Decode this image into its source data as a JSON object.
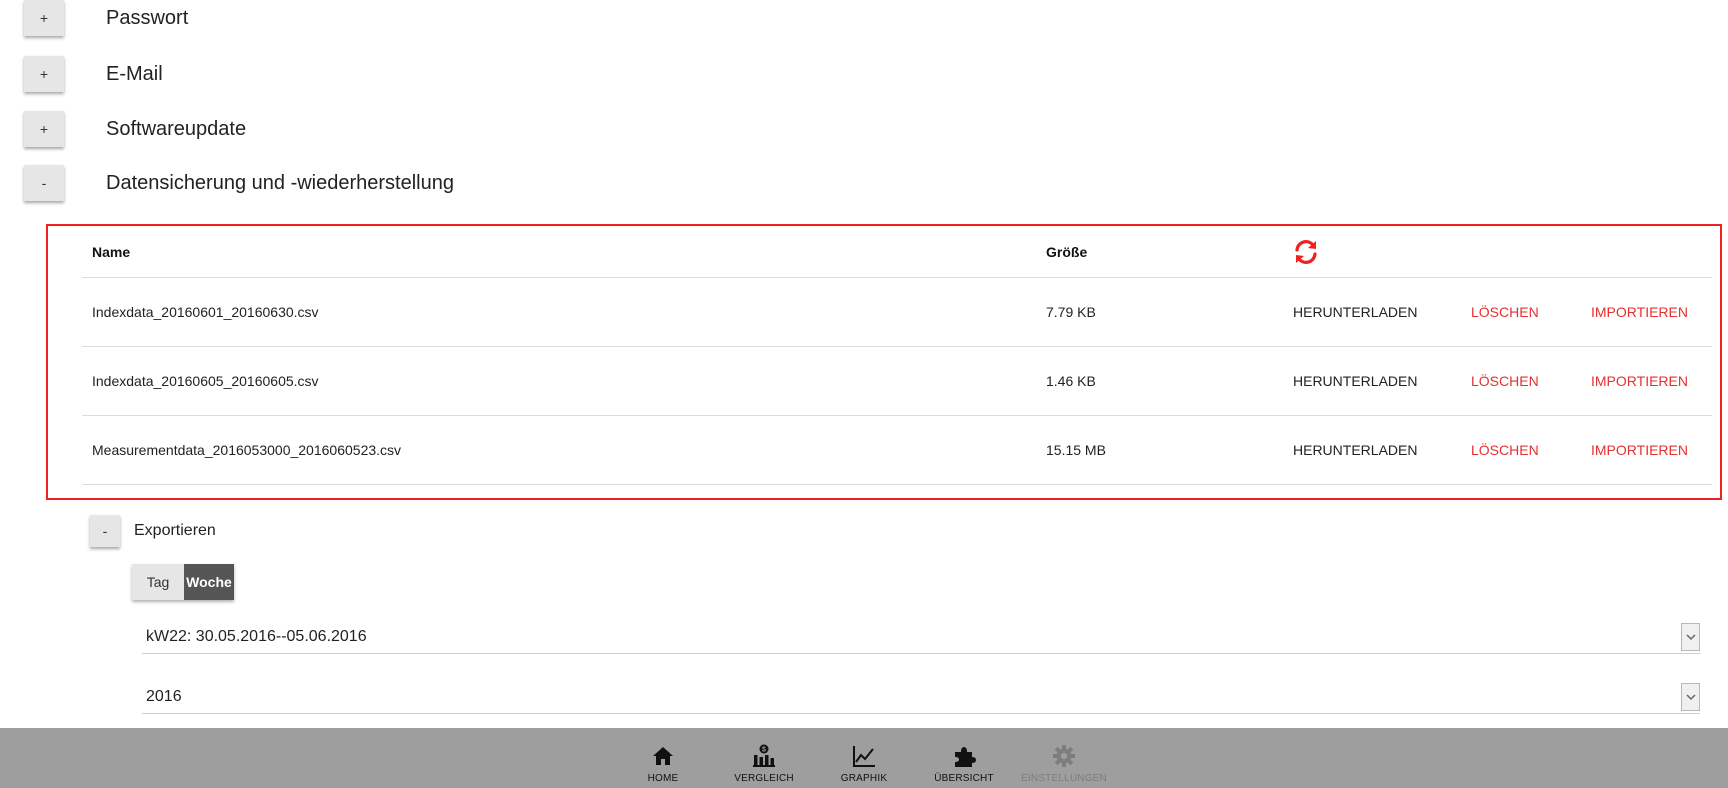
{
  "sections": [
    {
      "toggle": "+",
      "title": "Passwort"
    },
    {
      "toggle": "+",
      "title": "E-Mail"
    },
    {
      "toggle": "+",
      "title": "Softwareupdate"
    },
    {
      "toggle": "-",
      "title": "Datensicherung und -wiederherstellung"
    }
  ],
  "backup_table": {
    "headers": {
      "name": "Name",
      "size": "Größe",
      "refresh_icon": "refresh-icon"
    },
    "rows": [
      {
        "name": "Indexdata_20160601_20160630.csv",
        "size": "7.79 KB",
        "download": "HERUNTERLADEN",
        "delete": "LÖSCHEN",
        "import": "IMPORTIEREN"
      },
      {
        "name": "Indexdata_20160605_20160605.csv",
        "size": "1.46 KB",
        "download": "HERUNTERLADEN",
        "delete": "LÖSCHEN",
        "import": "IMPORTIEREN"
      },
      {
        "name": "Measurementdata_2016053000_2016060523.csv",
        "size": "15.15 MB",
        "download": "HERUNTERLADEN",
        "delete": "LÖSCHEN",
        "import": "IMPORTIEREN"
      }
    ]
  },
  "export": {
    "toggle": "-",
    "label": "Exportieren",
    "period_options": [
      {
        "label": "Tag",
        "selected": false
      },
      {
        "label": "Woche",
        "selected": true
      }
    ],
    "week_select": "kW22: 30.05.2016--05.06.2016",
    "year_select": "2016"
  },
  "bottom_nav": [
    {
      "label": "HOME",
      "icon": "home-icon",
      "disabled": false
    },
    {
      "label": "VERGLEICH",
      "icon": "comparison-icon",
      "disabled": false
    },
    {
      "label": "GRAPHIK",
      "icon": "chart-icon",
      "disabled": false
    },
    {
      "label": "ÜBERSICHT",
      "icon": "puzzle-icon",
      "disabled": false
    },
    {
      "label": "EINSTELLUNGEN",
      "icon": "gear-icon",
      "disabled": true
    }
  ],
  "colors": {
    "accent_red": "#e53030",
    "panel_border": "#ee2222",
    "nav_bg": "#9e9e9e",
    "selected_segment": "#555555"
  }
}
